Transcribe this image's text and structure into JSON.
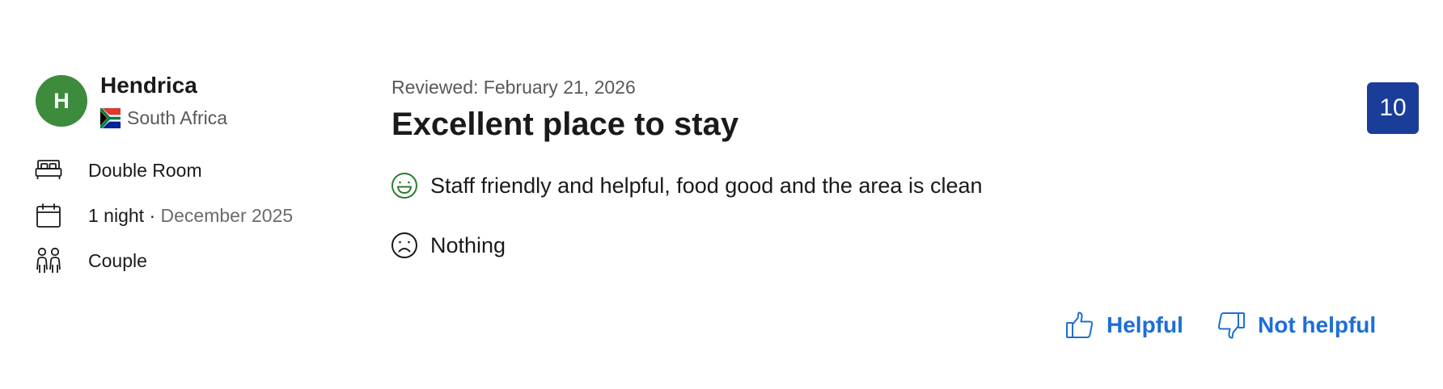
{
  "reviewer": {
    "initial": "H",
    "name": "Hendrica",
    "country": "South Africa",
    "flag_icon": "south-africa-flag-icon",
    "avatar_color": "#3d8b3d"
  },
  "stay": {
    "room": "Double Room",
    "nights": "1 night",
    "separator": " · ",
    "month": "December 2025",
    "traveler_type": "Couple"
  },
  "review": {
    "date": "Reviewed: February 21, 2026",
    "title": "Excellent place to stay",
    "positive": "Staff friendly and helpful, food good and the area is clean",
    "negative": "Nothing",
    "score": "10",
    "score_color": "#1a3d99",
    "positive_icon_color": "#2e7d32"
  },
  "feedback": {
    "helpful_label": "Helpful",
    "not_helpful_label": "Not helpful",
    "link_color": "#1d6ed8"
  },
  "icons": {
    "room": "bed-icon",
    "stay": "calendar-icon",
    "traveler": "people-icon",
    "positive": "smile-icon",
    "negative": "frown-icon",
    "helpful": "thumbs-up-icon",
    "not_helpful": "thumbs-down-icon"
  }
}
